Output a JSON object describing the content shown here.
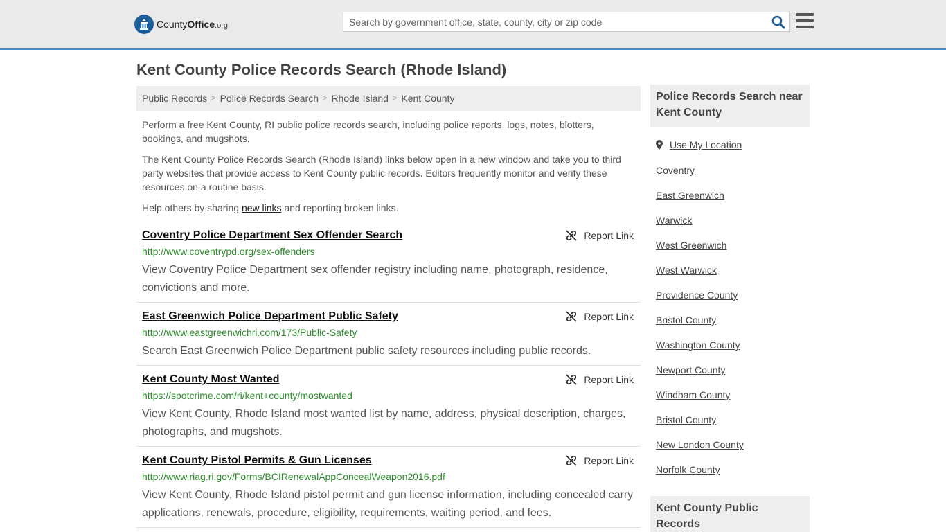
{
  "header": {
    "logo_text_prefix": "County",
    "logo_text_bold": "Office",
    "logo_text_suffix": ".org",
    "search_placeholder": "Search by government office, state, county, city or zip code",
    "accent_color": "#4a88c7"
  },
  "page_title": "Kent County Police Records Search (Rhode Island)",
  "breadcrumb": [
    "Public Records",
    "Police Records Search",
    "Rhode Island",
    "Kent County"
  ],
  "intro": {
    "p1": "Perform a free Kent County, RI public police records search, including police reports, logs, notes, blotters, bookings, and mugshots.",
    "p2": "The Kent County Police Records Search (Rhode Island) links below open in a new window and take you to third party websites that provide access to Kent County public records. Editors frequently monitor and verify these resources on a routine basis.",
    "p3_before": "Help others by sharing ",
    "p3_link": "new links",
    "p3_after": " and reporting broken links."
  },
  "report_label": "Report Link",
  "listings": [
    {
      "title": "Coventry Police Department Sex Offender Search",
      "url": "http://www.coventrypd.org/sex-offenders",
      "desc": "View Coventry Police Department sex offender registry including name, photograph, residence, convictions and more."
    },
    {
      "title": "East Greenwich Police Department Public Safety",
      "url": "http://www.eastgreenwichri.com/173/Public-Safety",
      "desc": "Search East Greenwich Police Department public safety resources including public records."
    },
    {
      "title": "Kent County Most Wanted",
      "url": "https://spotcrime.com/ri/kent+county/mostwanted",
      "desc": "View Kent County, Rhode Island most wanted list by name, address, physical description, charges, photographs, and mugshots."
    },
    {
      "title": "Kent County Pistol Permits & Gun Licenses",
      "url": "http://www.riag.ri.gov/Forms/BCIRenewalAppConcealWeapon2016.pdf",
      "desc": "View Kent County, Rhode Island pistol permit and gun license information, including concealed carry applications, renewals, procedure, eligibility, requirements, waiting period, and fees."
    }
  ],
  "sidebar": {
    "nearby_heading": "Police Records Search near Kent County",
    "use_location": "Use My Location",
    "links": [
      "Coventry",
      "East Greenwich",
      "Warwick",
      "West Greenwich",
      "West Warwick",
      "Providence County",
      "Bristol County",
      "Washington County",
      "Newport County",
      "Windham County",
      "Bristol County",
      "New London County",
      "Norfolk County"
    ],
    "public_records_heading": "Kent County Public Records"
  }
}
